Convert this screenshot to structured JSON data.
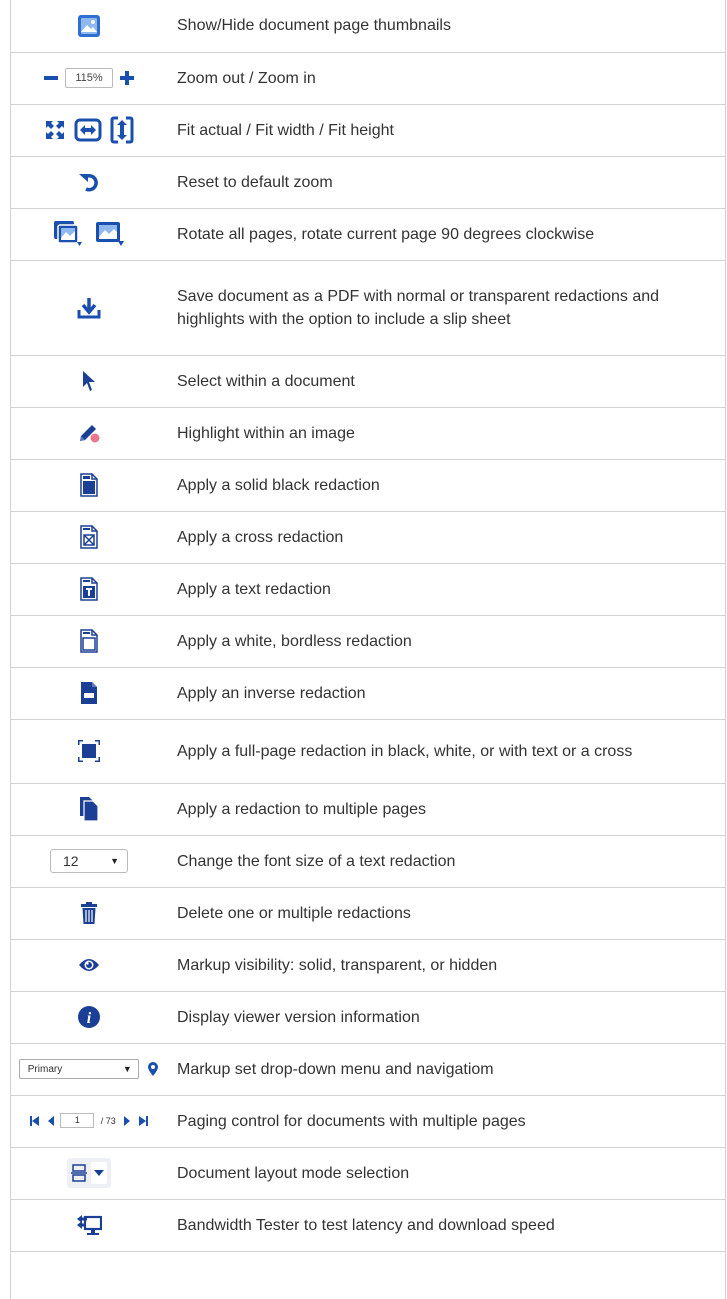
{
  "colors": {
    "icon_blue": "#1a4fae",
    "icon_navy": "#1c3f96",
    "icon_pink": "#e8778f",
    "border": "#d2d2d2",
    "text": "#333333"
  },
  "rows": [
    {
      "icon": "thumbnails-icon",
      "description": "Show/Hide document page thumbnails"
    },
    {
      "icon": "zoom-controls",
      "zoom_value": "115%",
      "description": "Zoom out / Zoom in"
    },
    {
      "icon": "fit-icons",
      "description": "Fit actual / Fit width / Fit height"
    },
    {
      "icon": "reset-zoom-icon",
      "description": "Reset to default zoom"
    },
    {
      "icon": "rotate-icons",
      "description": "Rotate all pages, rotate current page 90 degrees clockwise"
    },
    {
      "icon": "save-download-icon",
      "description": "Save document as a PDF with normal or transparent redactions and highlights with the option to include a slip sheet"
    },
    {
      "icon": "select-pointer-icon",
      "description": "Select within a document"
    },
    {
      "icon": "highlight-pen-icon",
      "description": "Highlight within an image"
    },
    {
      "icon": "solid-redaction-icon",
      "description": "Apply a solid black redaction"
    },
    {
      "icon": "cross-redaction-icon",
      "description": "Apply a cross redaction"
    },
    {
      "icon": "text-redaction-icon",
      "description": "Apply a text redaction"
    },
    {
      "icon": "white-redaction-icon",
      "description": "Apply a white, bordless redaction"
    },
    {
      "icon": "inverse-redaction-icon",
      "description": "Apply an inverse redaction"
    },
    {
      "icon": "full-page-redaction-icon",
      "description": "Apply a full-page redaction in black, white, or with text or a cross"
    },
    {
      "icon": "multi-page-redaction-icon",
      "description": "Apply a redaction to multiple pages"
    },
    {
      "icon": "font-size-select",
      "select_value": "12",
      "description": "Change the font size of a text redaction"
    },
    {
      "icon": "trash-icon",
      "description": "Delete one or multiple redactions"
    },
    {
      "icon": "eye-icon",
      "description": "Markup visibility: solid, transparent, or hidden"
    },
    {
      "icon": "info-icon",
      "description": "Display viewer version information"
    },
    {
      "icon": "markup-set-select",
      "select_value": "Primary",
      "description": "Markup set drop-down menu and navigatiom"
    },
    {
      "icon": "paging-control",
      "page_value": "1",
      "page_total": "/ 73",
      "description": "Paging control for documents with multiple pages"
    },
    {
      "icon": "layout-mode-icon",
      "description": "Document layout mode selection"
    },
    {
      "icon": "bandwidth-tester-icon",
      "description": "Bandwidth Tester to test latency and download speed"
    }
  ]
}
